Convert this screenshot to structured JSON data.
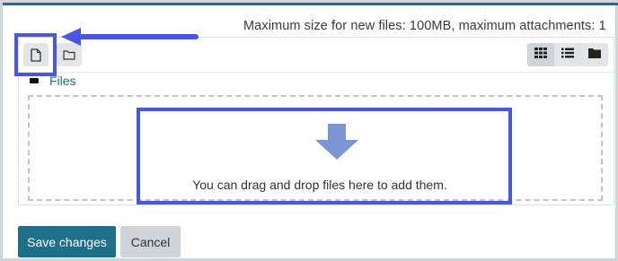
{
  "header": {
    "max_size_text": "Maximum size for new files: 100MB, maximum attachments: 1"
  },
  "toolbar": {
    "add_file_icon": "file-icon",
    "create_folder_icon": "folder-outline-icon",
    "view_icons": [
      "grid-view-icon",
      "list-view-icon",
      "folder-tree-icon"
    ]
  },
  "path": {
    "label": "Files"
  },
  "drop_zone": {
    "text": "You can drag and drop files here to add them."
  },
  "actions": {
    "save_label": "Save changes",
    "cancel_label": "Cancel"
  },
  "colors": {
    "accent": "#1f6f8b",
    "annotation": "#4a55e0",
    "button_gray": "#ced4da"
  }
}
